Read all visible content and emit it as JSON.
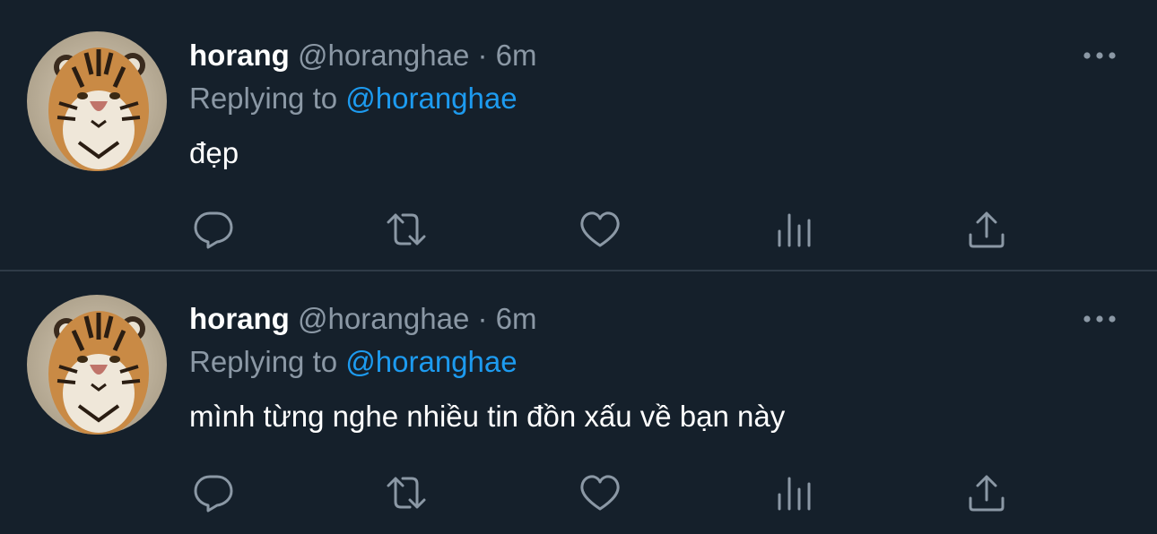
{
  "colors": {
    "background": "#15202b",
    "divider": "#2f3b47",
    "text_primary": "#ffffff",
    "text_secondary": "#8b98a5",
    "accent": "#1d9bf0"
  },
  "tweets": [
    {
      "name": "horang",
      "handle": "@horanghae",
      "separator": "·",
      "time": "6m",
      "replying_prefix": "Replying to",
      "replying_to": "@horanghae",
      "text": "đẹp",
      "avatar": "tiger-avatar",
      "actions": [
        "reply-icon",
        "retweet-icon",
        "like-icon",
        "views-icon",
        "share-icon"
      ],
      "more": "more-options-icon"
    },
    {
      "name": "horang",
      "handle": "@horanghae",
      "separator": "·",
      "time": "6m",
      "replying_prefix": "Replying to",
      "replying_to": "@horanghae",
      "text": "mình từng nghe nhiều tin đồn xấu về bạn này",
      "avatar": "tiger-avatar",
      "actions": [
        "reply-icon",
        "retweet-icon",
        "like-icon",
        "views-icon",
        "share-icon"
      ],
      "more": "more-options-icon"
    }
  ]
}
